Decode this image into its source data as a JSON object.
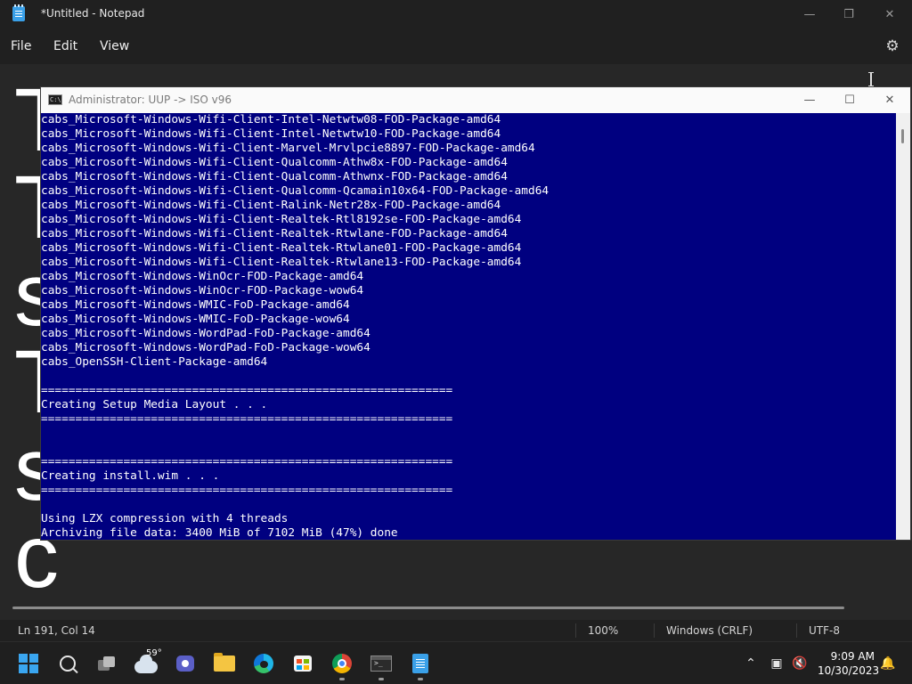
{
  "notepad": {
    "title": "*Untitled - Notepad",
    "menu": [
      "File",
      "Edit",
      "View"
    ],
    "content_fragment": "T\nT\ns\nT\ns\nc",
    "status": {
      "position": "Ln 191, Col 14",
      "zoom": "100%",
      "line_ending": "Windows (CRLF)",
      "encoding": "UTF-8"
    },
    "icons": {
      "app": "notepad-icon",
      "settings": "gear-icon"
    }
  },
  "console": {
    "title": "Administrator:  UUP -> ISO v96",
    "icon": "cmd-icon",
    "lines": [
      "cabs_Microsoft-Windows-Wifi-Client-Intel-Netwtw08-FOD-Package-amd64",
      "cabs_Microsoft-Windows-Wifi-Client-Intel-Netwtw10-FOD-Package-amd64",
      "cabs_Microsoft-Windows-Wifi-Client-Marvel-Mrvlpcie8897-FOD-Package-amd64",
      "cabs_Microsoft-Windows-Wifi-Client-Qualcomm-Athw8x-FOD-Package-amd64",
      "cabs_Microsoft-Windows-Wifi-Client-Qualcomm-Athwnx-FOD-Package-amd64",
      "cabs_Microsoft-Windows-Wifi-Client-Qualcomm-Qcamain10x64-FOD-Package-amd64",
      "cabs_Microsoft-Windows-Wifi-Client-Ralink-Netr28x-FOD-Package-amd64",
      "cabs_Microsoft-Windows-Wifi-Client-Realtek-Rtl8192se-FOD-Package-amd64",
      "cabs_Microsoft-Windows-Wifi-Client-Realtek-Rtwlane-FOD-Package-amd64",
      "cabs_Microsoft-Windows-Wifi-Client-Realtek-Rtwlane01-FOD-Package-amd64",
      "cabs_Microsoft-Windows-Wifi-Client-Realtek-Rtwlane13-FOD-Package-amd64",
      "cabs_Microsoft-Windows-WinOcr-FOD-Package-amd64",
      "cabs_Microsoft-Windows-WinOcr-FOD-Package-wow64",
      "cabs_Microsoft-Windows-WMIC-FoD-Package-amd64",
      "cabs_Microsoft-Windows-WMIC-FoD-Package-wow64",
      "cabs_Microsoft-Windows-WordPad-FoD-Package-amd64",
      "cabs_Microsoft-Windows-WordPad-FoD-Package-wow64",
      "cabs_OpenSSH-Client-Package-amd64",
      "",
      "============================================================",
      "Creating Setup Media Layout . . .",
      "============================================================",
      "",
      "",
      "============================================================",
      "Creating install.wim . . .",
      "============================================================",
      "",
      "Using LZX compression with 4 threads",
      "Archiving file data: 3400 MiB of 7102 MiB (47%) done"
    ],
    "progress_percent": 47
  },
  "taskbar": {
    "weather_temp": "59°",
    "clock_time": "9:09 AM",
    "clock_date": "10/30/2023",
    "apps": [
      {
        "name": "start",
        "icon": "windows-start-icon"
      },
      {
        "name": "search",
        "icon": "search-icon"
      },
      {
        "name": "task-view",
        "icon": "task-view-icon"
      },
      {
        "name": "weather",
        "icon": "cloud-icon"
      },
      {
        "name": "teams",
        "icon": "meet-icon"
      },
      {
        "name": "file-explorer",
        "icon": "folder-icon"
      },
      {
        "name": "edge",
        "icon": "edge-icon"
      },
      {
        "name": "store",
        "icon": "store-icon"
      },
      {
        "name": "chrome",
        "icon": "chrome-icon"
      },
      {
        "name": "terminal",
        "icon": "terminal-icon"
      },
      {
        "name": "notepad",
        "icon": "notepad-icon"
      }
    ],
    "tray": [
      "chevron-up-icon",
      "network-icon",
      "volume-muted-icon",
      "notification-icon"
    ]
  },
  "colors": {
    "console_bg": "#000080",
    "notepad_bg": "#272727",
    "titlebar_bg": "#202020",
    "taskbar_bg": "#1f1f1f"
  }
}
